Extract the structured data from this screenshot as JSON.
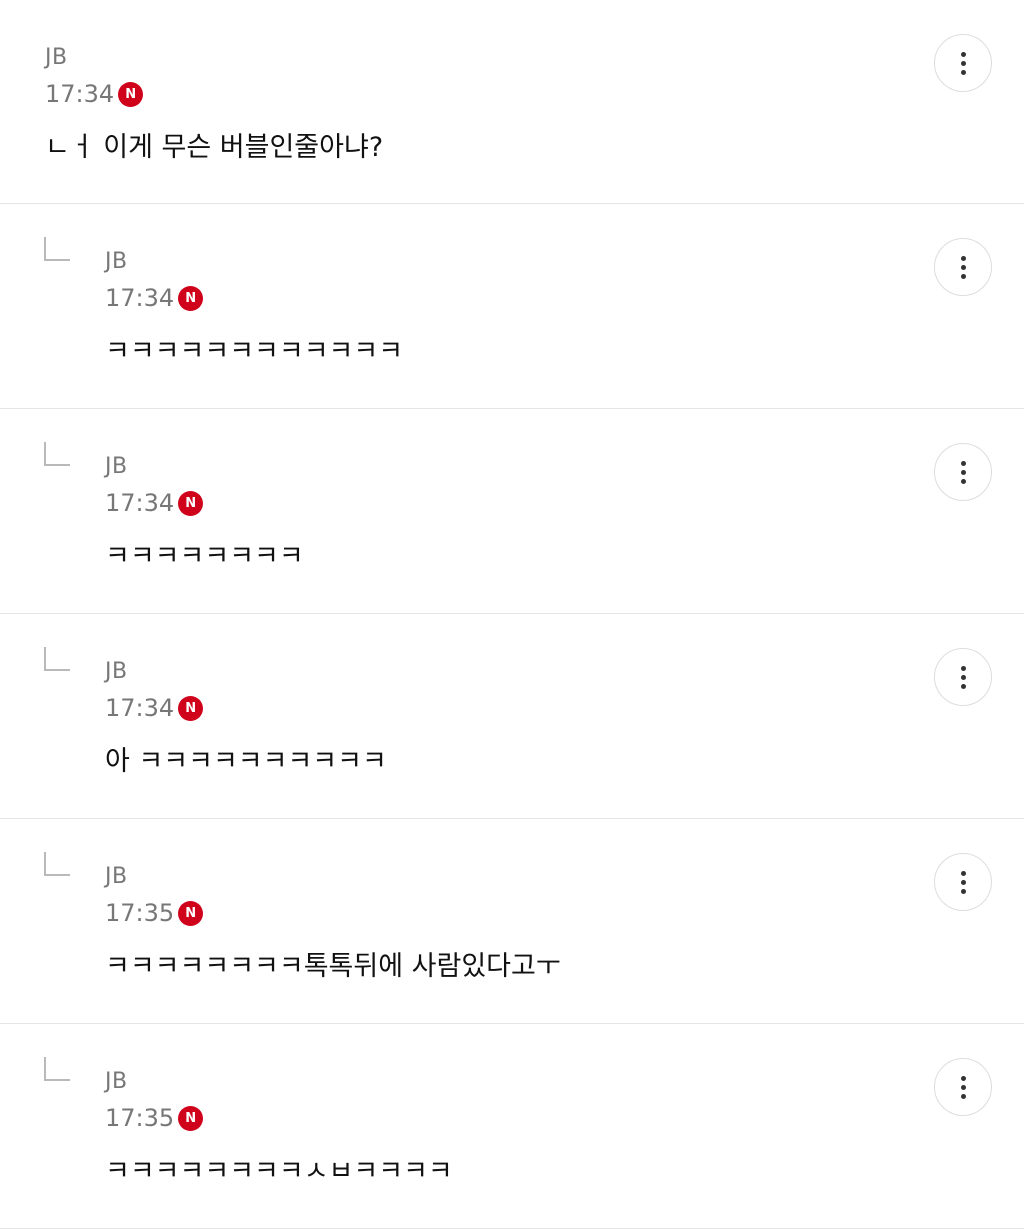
{
  "comments": [
    {
      "author": "JB",
      "time": "17:34",
      "badge": "N",
      "text": "ㄴㅓ 이게 무슨 버블인줄아냐?",
      "reply": false
    },
    {
      "author": "JB",
      "time": "17:34",
      "badge": "N",
      "text": "ㅋㅋㅋㅋㅋㅋㅋㅋㅋㅋㅋㅋ",
      "reply": true
    },
    {
      "author": "JB",
      "time": "17:34",
      "badge": "N",
      "text": "ㅋㅋㅋㅋㅋㅋㅋㅋ",
      "reply": true
    },
    {
      "author": "JB",
      "time": "17:34",
      "badge": "N",
      "text": "아 ㅋㅋㅋㅋㅋㅋㅋㅋㅋㅋ",
      "reply": true
    },
    {
      "author": "JB",
      "time": "17:35",
      "badge": "N",
      "text": "ㅋㅋㅋㅋㅋㅋㅋㅋ톡톡뒤에 사람있다고ㅜ",
      "reply": true
    },
    {
      "author": "JB",
      "time": "17:35",
      "badge": "N",
      "text": "ㅋㅋㅋㅋㅋㅋㅋㅋㅅㅂㅋㅋㅋㅋ",
      "reply": true
    }
  ],
  "icons": {
    "more": "more-vertical-icon",
    "reply": "reply-arrow-icon",
    "new": "new-badge-icon"
  },
  "colors": {
    "badge": "#d0021b",
    "muted_text": "#777777",
    "divider": "#e5e5e5"
  }
}
